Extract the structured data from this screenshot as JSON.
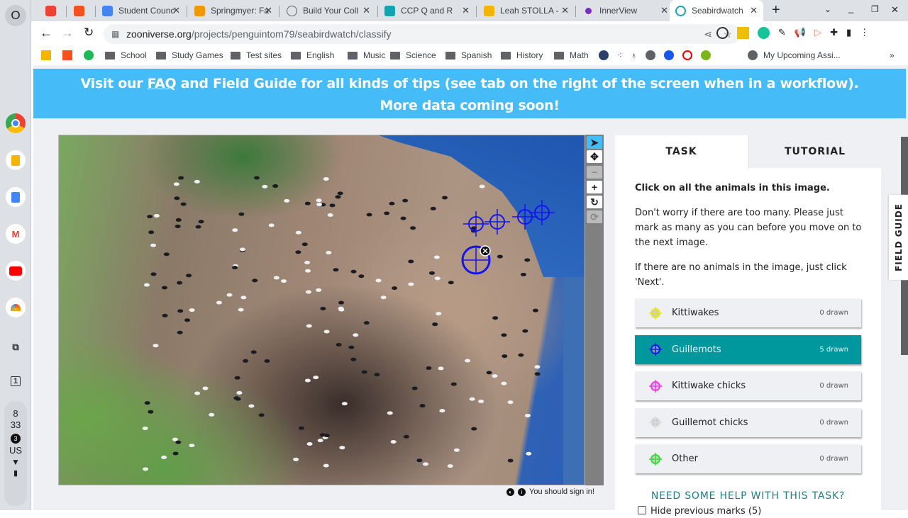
{
  "os": {
    "launcher": "O",
    "clock_hour": "8",
    "clock_min": "33",
    "notif_count": "3",
    "locale": "US"
  },
  "tabs": [
    {
      "label": "",
      "color": "#ea4335"
    },
    {
      "label": "",
      "color": "#f4511e"
    },
    {
      "label": "Student Counc",
      "color": "#4285f4"
    },
    {
      "label": "Springmyer: Fa",
      "color": "#f29900"
    },
    {
      "label": "Build Your Coll",
      "color": "#5f6368"
    },
    {
      "label": "CCP Q and R",
      "color": "#12a4af"
    },
    {
      "label": "Leah STOLLA -",
      "color": "#f4b400"
    },
    {
      "label": "InnerView",
      "color": "#7b2cbf"
    },
    {
      "label": "Seabirdwatch",
      "color": "#1ea0b4"
    }
  ],
  "address": {
    "host": "zooniverse.org",
    "path": "/projects/penguintom79/seabirdwatch/classify"
  },
  "bookmarks": [
    "School",
    "Study Games",
    "Test sites",
    "English",
    "Music",
    "Science",
    "Spanish",
    "History",
    "Math"
  ],
  "bookmark_last": "My Upcoming Assi...",
  "banner": {
    "pre": "Visit our ",
    "link": "FAQ",
    "post": " and Field Guide for all kinds of tips (see tab on the right of the screen when in a workflow).",
    "line2": "More data coming soon!"
  },
  "signin": "You should sign in!",
  "panel": {
    "tabs": [
      "TASK",
      "TUTORIAL"
    ],
    "question": "Click on all the animals in this image.",
    "help1": "Don't worry if there are too many. Please just mark as many as you can before you move on to the next image.",
    "help2": "If there are no animals in the image, just click 'Next'.",
    "tools": [
      {
        "label": "Kittiwakes",
        "count": "0 drawn",
        "color": "#e8e81a",
        "selected": false
      },
      {
        "label": "Guillemots",
        "count": "5 drawn",
        "color": "#1a1ae8",
        "selected": true
      },
      {
        "label": "Kittiwake chicks",
        "count": "0 drawn",
        "color": "#ee3ee8",
        "selected": false
      },
      {
        "label": "Guillemot chicks",
        "count": "0 drawn",
        "color": "#dddddd",
        "selected": false
      },
      {
        "label": "Other",
        "count": "0 drawn",
        "color": "#33dd33",
        "selected": false
      }
    ],
    "need_help": "NEED SOME HELP WITH THIS TASK?",
    "hide_marks": "Hide previous marks (5)"
  },
  "field_guide": "FIELD GUIDE"
}
